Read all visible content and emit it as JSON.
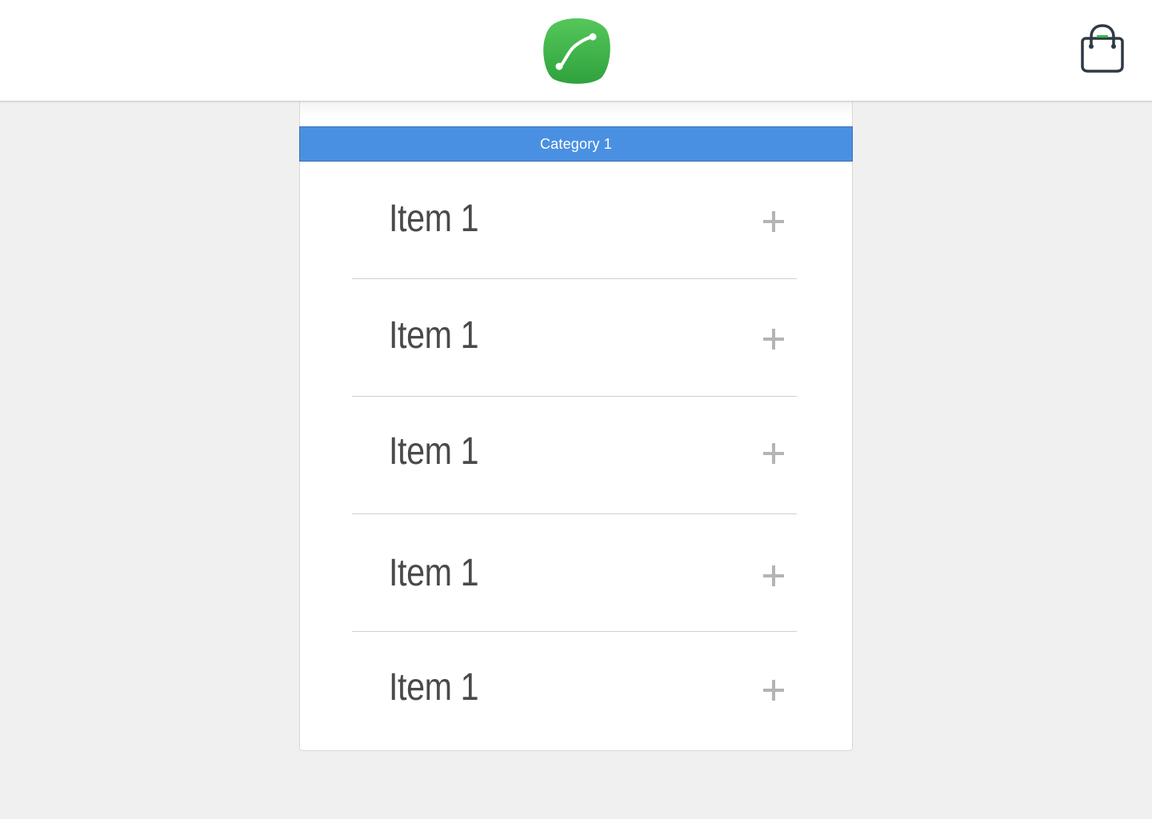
{
  "header": {
    "logo_icon": "green-curve-logo-icon",
    "bag_icon": "shopping-bag-icon",
    "brand_color": "#3cb54a"
  },
  "menu": {
    "category_label": "Category 1",
    "category_color": "#4a90e2",
    "items": [
      {
        "name": "Item 1",
        "action_icon": "plus-icon"
      },
      {
        "name": "Item 1",
        "action_icon": "plus-icon"
      },
      {
        "name": "Item 1",
        "action_icon": "plus-icon"
      },
      {
        "name": "Item 1",
        "action_icon": "plus-icon"
      },
      {
        "name": "Item 1",
        "action_icon": "plus-icon"
      }
    ]
  }
}
